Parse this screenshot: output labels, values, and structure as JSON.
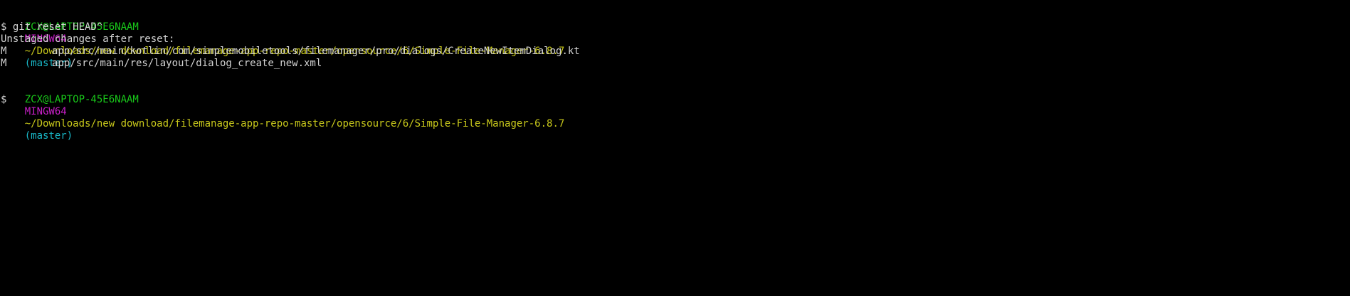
{
  "session": {
    "prompt1": {
      "user_host": "ZCX@LAPTOP-45E6NAAM",
      "shell": "MINGW64",
      "path": "~/Downloads/new download/filemanage-app-repo-master/opensource/6/Simple-File-Manager-6.8.7",
      "branch": "(master)"
    },
    "command1": "$ git reset HEAD^",
    "output": {
      "header": "Unstaged changes after reset:",
      "files": [
        {
          "status": "M",
          "path": "app/src/main/kotlin/com/simplemobiletools/filemanager/pro/dialogs/CreateNewItemDialog.kt"
        },
        {
          "status": "M",
          "path": "app/src/main/res/layout/dialog_create_new.xml"
        }
      ]
    },
    "prompt2": {
      "user_host": "ZCX@LAPTOP-45E6NAAM",
      "shell": "MINGW64",
      "path": "~/Downloads/new download/filemanage-app-repo-master/opensource/6/Simple-File-Manager-6.8.7",
      "branch": "(master)"
    },
    "command2": "$"
  },
  "colors": {
    "background": "#000000",
    "user": "#19c81a",
    "shell": "#c71fc7",
    "path": "#c8c81b",
    "branch": "#19b8c8",
    "text": "#d3d3d3"
  }
}
